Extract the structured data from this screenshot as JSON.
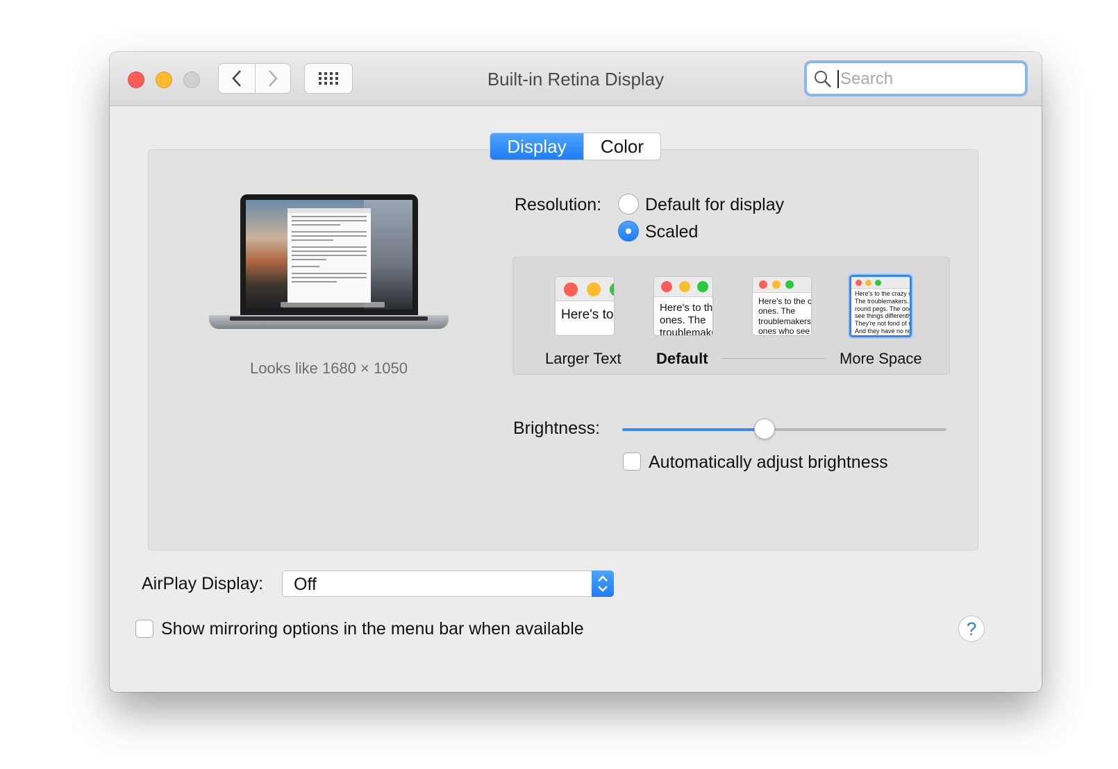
{
  "window": {
    "title": "Built-in Retina Display",
    "search_placeholder": "Search"
  },
  "tabs": [
    {
      "label": "Display",
      "selected": true
    },
    {
      "label": "Color",
      "selected": false
    }
  ],
  "display": {
    "looks_like": "Looks like 1680 × 1050",
    "resolution_label": "Resolution:",
    "resolution_options": [
      {
        "label": "Default for display",
        "selected": false
      },
      {
        "label": "Scaled",
        "selected": true
      }
    ],
    "scaled_options": [
      {
        "label": "Larger Text",
        "preview": "Here's to the crazy ones. The troublemakers."
      },
      {
        "label": "Default",
        "preview": "Here's to the crazy ones. The troublemakers. The ones who see"
      },
      {
        "label": "",
        "preview": "Here's to the crazy ones. The troublemakers. The ones who see things differently. They're not fond of rules. And they"
      },
      {
        "label": "More Space",
        "preview": "Here's to the crazy ones. The troublemakers. The round pegs. The ones who see things differently. They're not fond of rules. And they have no respect. You can quote them, disagree with them. About the only thing. Because they change things."
      }
    ],
    "selected_scaled_index": 3,
    "bold_scaled_index": 1,
    "brightness_label": "Brightness:",
    "brightness_value": 0.44,
    "auto_brightness_label": "Automatically adjust brightness",
    "auto_brightness_checked": false
  },
  "airplay": {
    "label": "AirPlay Display:",
    "value": "Off"
  },
  "mirroring": {
    "label": "Show mirroring options in the menu bar when available",
    "checked": false
  },
  "help_label": "?",
  "colors": {
    "accent": "#1e7df8",
    "close": "#fc5f57",
    "minimize": "#fdbb2e",
    "zoom_disabled": "#d0d0d0"
  },
  "icons": [
    "back-arrow-icon",
    "forward-arrow-icon",
    "grid-icon",
    "search-icon",
    "select-arrows-icon"
  ]
}
